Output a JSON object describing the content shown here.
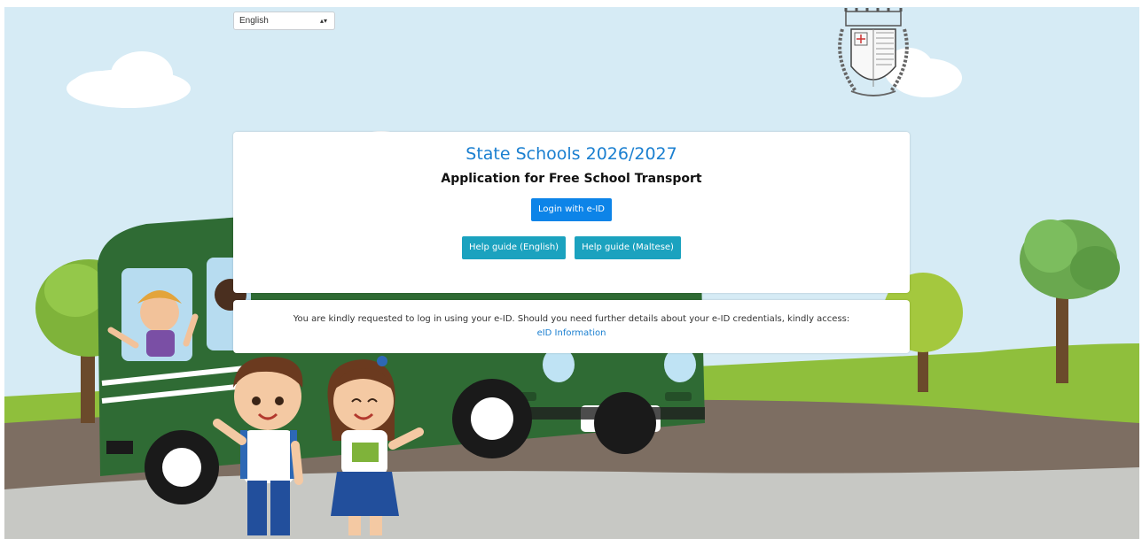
{
  "language_select": {
    "selected": "English"
  },
  "header": {
    "title": "State Schools 2026/2027",
    "subtitle": "Application for Free School Transport"
  },
  "actions": {
    "login_label": "Login with e-ID",
    "help_english_label": "Help guide (English)",
    "help_maltese_label": "Help guide (Maltese)"
  },
  "info": {
    "message": "You are kindly requested to log in using your e-ID. Should you need further details about your e-ID credentials, kindly access:",
    "link_label": "eID Information"
  },
  "colors": {
    "accent_blue": "#1a7fd0",
    "login_button": "#0d84e8",
    "help_button": "#1ba2bf",
    "sky": "#d6ebf5",
    "bus_green": "#2f6b34",
    "grass": "#8fbf3c",
    "road": "#7d6e62"
  },
  "icons": {
    "emblem": "malta-coat-of-arms",
    "select_caret": "updown-caret-icon"
  }
}
